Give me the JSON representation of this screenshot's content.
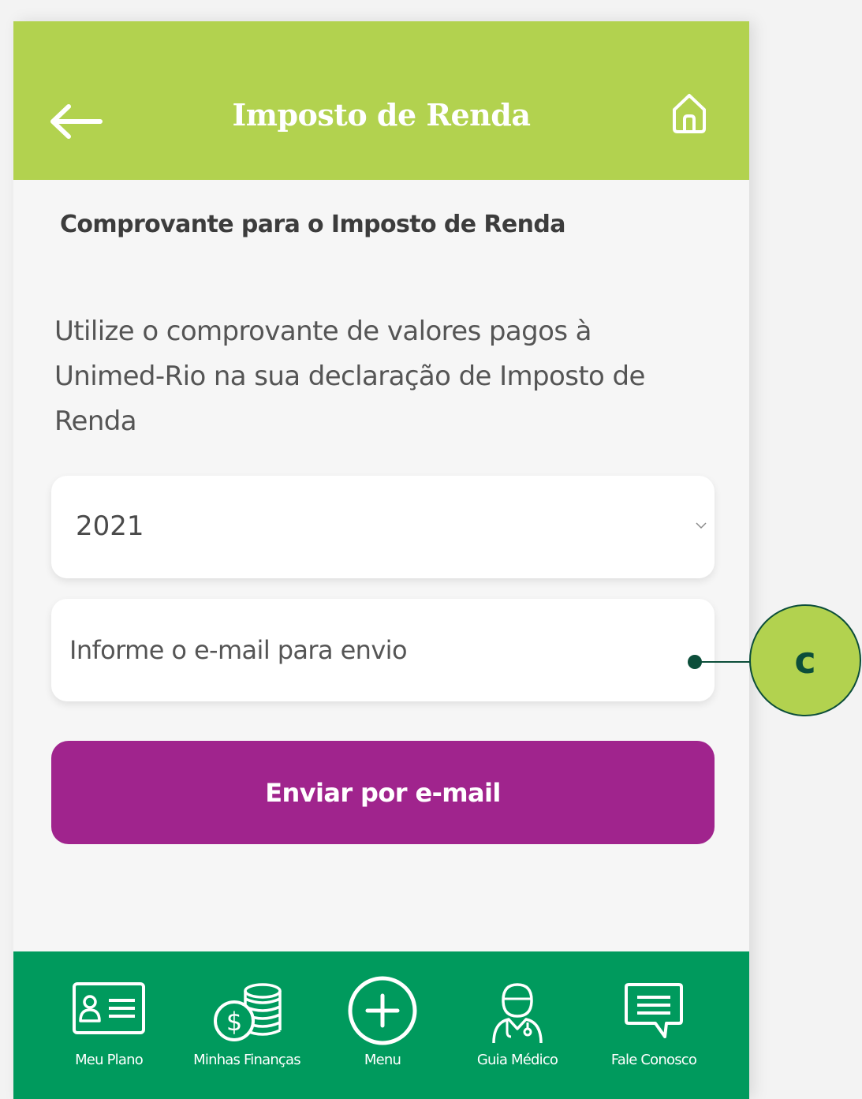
{
  "header": {
    "title": "Imposto de Renda",
    "back_icon": "arrow-left-icon",
    "home_icon": "home-icon",
    "background_color": "#b2d24f"
  },
  "content": {
    "section_title": "Comprovante para o Imposto de Renda",
    "description": "Utilize o comprovante de valores pagos à Unimed-Rio na sua declaração de Imposto de Renda",
    "year_select": {
      "selected_value": "2021"
    },
    "email_field": {
      "placeholder": "Informe o e-mail para envio",
      "value": ""
    },
    "send_button_label": "Enviar por e-mail",
    "send_button_color": "#a0248d"
  },
  "bottom_nav": {
    "background_color": "#009a5d",
    "items": [
      {
        "label": "Meu Plano",
        "icon": "id-card-icon"
      },
      {
        "label": "Minhas Finanças",
        "icon": "coins-icon"
      },
      {
        "label": "Menu",
        "icon": "plus-circle-icon"
      },
      {
        "label": "Guia Médico",
        "icon": "doctor-icon"
      },
      {
        "label": "Fale Conosco",
        "icon": "chat-bubble-icon"
      }
    ]
  },
  "callout": {
    "label": "c"
  }
}
